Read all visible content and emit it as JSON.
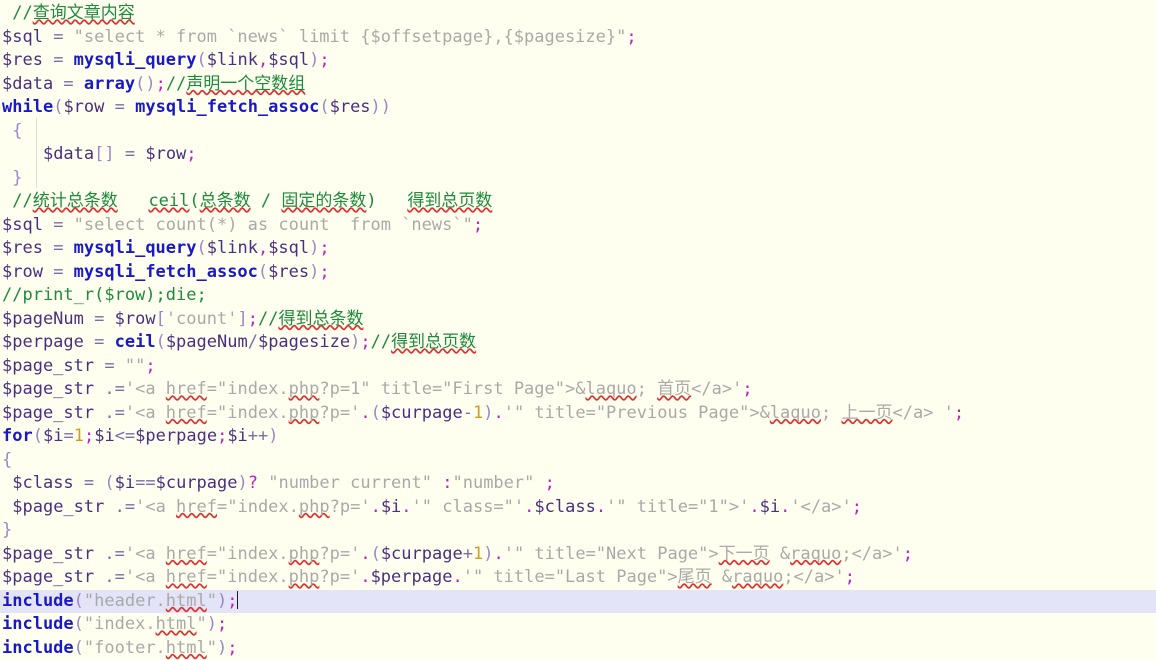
{
  "editor": {
    "language": "php",
    "background_color": "#FFFFF0",
    "highlight_line_color": "#E4E4F8",
    "comment_color": "#1E8B3C",
    "keyword_color": "#1919C8",
    "variable_color": "#4B2E83",
    "string_color": "#A9A9A9",
    "number_color": "#D49A20",
    "punctuation_color": "#C020C0",
    "spellcheck_underline_color": "#E03030",
    "caret_line_index": 24
  },
  "code": {
    "lines": [
      {
        "n": 1,
        "text": "//查询文章内容"
      },
      {
        "n": 2,
        "text": "$sql = \"select * from `news` limit {$offsetpage},{$pagesize}\";"
      },
      {
        "n": 3,
        "text": "$res = mysqli_query($link,$sql);"
      },
      {
        "n": 4,
        "text": "$data = array();//声明一个空数组"
      },
      {
        "n": 5,
        "text": "while($row = mysqli_fetch_assoc($res))"
      },
      {
        "n": 6,
        "text": " {"
      },
      {
        "n": 7,
        "text": "    $data[] = $row;"
      },
      {
        "n": 8,
        "text": " }"
      },
      {
        "n": 9,
        "text": " //统计总条数   ceil(总条数 / 固定的条数)   得到总页数"
      },
      {
        "n": 10,
        "text": "$sql = \"select count(*) as count  from `news`\";"
      },
      {
        "n": 11,
        "text": "$res = mysqli_query($link,$sql);"
      },
      {
        "n": 12,
        "text": "$row = mysqli_fetch_assoc($res);"
      },
      {
        "n": 13,
        "text": "//print_r($row);die;"
      },
      {
        "n": 14,
        "text": "$pageNum = $row['count'];//得到总条数"
      },
      {
        "n": 15,
        "text": "$perpage = ceil($pageNum/$pagesize);//得到总页数"
      },
      {
        "n": 16,
        "text": "$page_str = \"\";"
      },
      {
        "n": 17,
        "text": "$page_str .='<a href=\"index.php?p=1\" title=\"First Page\">&laquo; 首页</a>';"
      },
      {
        "n": 18,
        "text": "$page_str .='<a href=\"index.php?p='.($curpage-1).'\" title=\"Previous Page\">&laquo; 上一页</a> ';"
      },
      {
        "n": 19,
        "text": "for($i=1;$i<=$perpage;$i++)"
      },
      {
        "n": 20,
        "text": "{"
      },
      {
        "n": 21,
        "text": " $class = ($i==$curpage)? \"number current\" :\"number\" ;"
      },
      {
        "n": 22,
        "text": " $page_str .='<a href=\"index.php?p='.$i.'\" class=\"'.$class.'\" title=\"1\">'.$i.'</a>';"
      },
      {
        "n": 23,
        "text": "}"
      },
      {
        "n": 24,
        "text": "$page_str .='<a href=\"index.php?p='.($curpage+1).'\" title=\"Next Page\">下一页 &raquo;</a>';"
      },
      {
        "n": 25,
        "text": "$page_str .='<a href=\"index.php?p='.$perpage.'\" title=\"Last Page\">尾页 &raquo;</a>';"
      },
      {
        "n": 26,
        "text": "include(\"header.html\");"
      },
      {
        "n": 27,
        "text": "include(\"index.html\");"
      },
      {
        "n": 28,
        "text": "include(\"footer.html\");"
      }
    ]
  },
  "tokens": {
    "l1": {
      "c1": "//查询文章内容"
    },
    "l2": {
      "v1": "$sql",
      "o1": " = ",
      "s1": "\"select * from `news` limit {$offsetpage},{$pagesize}\"",
      "p1": ";"
    },
    "l3": {
      "v1": "$res",
      "o1": " = ",
      "f1": "mysqli_query",
      "b1": "(",
      "v2": "$link",
      "p1": ",",
      "v3": "$sql",
      "b2": ")",
      "p2": ";"
    },
    "l4": {
      "v1": "$data",
      "o1": " = ",
      "f1": "array",
      "b1": "()",
      "p1": ";",
      "c1": "//声明一个空数组"
    },
    "l5": {
      "k1": "while",
      "b1": "(",
      "v1": "$row",
      "o1": " = ",
      "f1": "mysqli_fetch_assoc",
      "b2": "(",
      "v2": "$res",
      "b3": "))"
    },
    "l6": {
      "b1": "{"
    },
    "l7": {
      "v1": "$data",
      "b1": "[]",
      "o1": " = ",
      "v2": "$row",
      "p1": ";"
    },
    "l8": {
      "b1": "}"
    },
    "l9": {
      "c1": "//统计总条数",
      "c2": "   ceil(",
      "c3": "总条数",
      "c4": " / ",
      "c5": "固定的条数",
      "c6": ")   ",
      "c7": "得到总页数"
    },
    "l10": {
      "v1": "$sql",
      "o1": " = ",
      "s1": "\"select count(*) as count  from `news`\"",
      "p1": ";"
    },
    "l13": {
      "c1": "//print_r($row);die;"
    },
    "l14": {
      "v1": "$pageNum",
      "o1": " = ",
      "v2": "$row",
      "b1": "[",
      "s1": "'count'",
      "b2": "]",
      "p1": ";",
      "c1": "//得到总条数"
    },
    "l15": {
      "v1": "$perpage",
      "o1": " = ",
      "f1": "ceil",
      "b1": "(",
      "v2": "$pageNum",
      "o2": "/",
      "v3": "$pagesize",
      "b2": ")",
      "p1": ";",
      "c1": "//得到总页数"
    },
    "l16": {
      "v1": "$page_str",
      "o1": " = ",
      "s1": "\"\"",
      "p1": ";"
    },
    "l19": {
      "k1": "for",
      "b1": "(",
      "v1": "$i",
      "o1": "=",
      "n1": "1",
      "p1": ";",
      "v2": "$i",
      "o2": "<=",
      "v3": "$perpage",
      "p2": ";",
      "v4": "$i",
      "o3": "++",
      "b2": ")"
    },
    "l26": {
      "k1": "include",
      "b1": "(",
      "s1": "\"header.html\"",
      "b2": ")",
      "p1": ";"
    },
    "l27": {
      "k1": "include",
      "b1": "(",
      "s1": "\"index.html\"",
      "b2": ")",
      "p1": ";"
    },
    "l28": {
      "k1": "include",
      "b1": "(",
      "s1": "\"footer.html\"",
      "b2": ")",
      "p1": ";"
    }
  },
  "misspelled_words": [
    "查询文章内容",
    "声明一个空数组",
    "统计总条数",
    "ceil",
    "总条数",
    "固定的条数",
    "得到总页数",
    "得到总条数",
    "href",
    "php",
    "首页",
    "laquo",
    "上一页",
    "下一页",
    "raquo",
    "尾页",
    "html"
  ]
}
